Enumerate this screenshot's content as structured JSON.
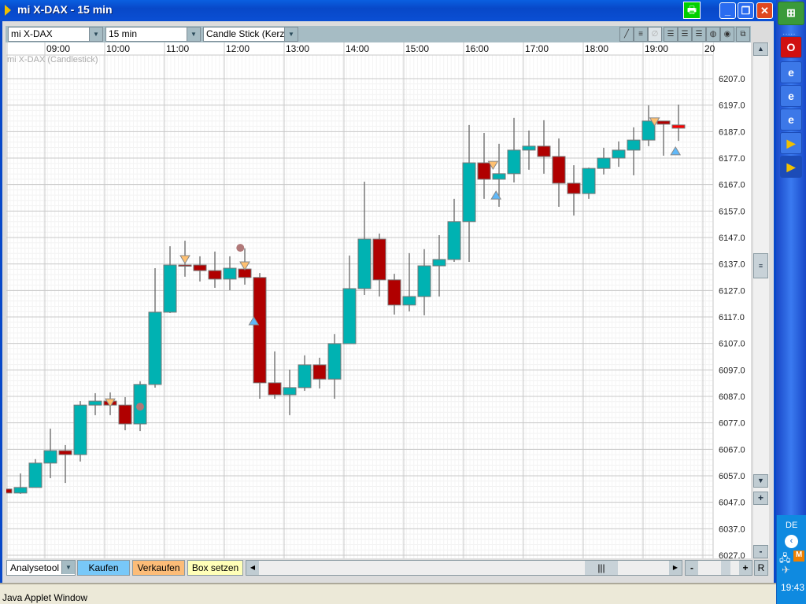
{
  "window": {
    "title": "mi X-DAX - 15 min",
    "status": "Java Applet Window"
  },
  "toolbar": {
    "instrument": "mi X-DAX",
    "interval": "15 min",
    "chart_type": "Candle Stick (Kerzen"
  },
  "chart_label": "mi X-DAX (Candlestick)",
  "bottom": {
    "tool": "Analysetool",
    "buy": "Kaufen",
    "sell": "Verkaufen",
    "box": "Box setzen",
    "reset": "R"
  },
  "taskbar": {
    "lang": "DE",
    "clock": "19:43"
  },
  "colors": {
    "up": "#00b2b2",
    "down": "#b00000",
    "current": "#ff0000",
    "sell_marker": "#ffc070",
    "buy_marker": "#60b8f8",
    "circle": "#b07878"
  },
  "chart_data": {
    "type": "candlestick",
    "title": "mi X-DAX (Candlestick)",
    "interval": "15 min",
    "time_ticks": [
      "",
      "09:00",
      "10:00",
      "11:00",
      "12:00",
      "13:00",
      "14:00",
      "15:00",
      "16:00",
      "17:00",
      "18:00",
      "19:00",
      "20"
    ],
    "price_ticks": [
      "6207.0",
      "6197.0",
      "6187.0",
      "6177.0",
      "6167.0",
      "6157.0",
      "6147.0",
      "6137.0",
      "6127.0",
      "6117.0",
      "6107.0",
      "6097.0",
      "6087.0",
      "6077.0",
      "6067.0",
      "6057.0",
      "6047.0",
      "6037.0",
      "6027.0"
    ],
    "ylim": [
      6027,
      6207
    ],
    "candles": [
      [
        6052.0,
        6050.5,
        6052.0,
        6050.5
      ],
      [
        6050.5,
        6052.6,
        6057.9,
        6050.2
      ],
      [
        6052.6,
        6061.8,
        6063.3,
        6052.6
      ],
      [
        6061.8,
        6066.5,
        6074.8,
        6056.1
      ],
      [
        6066.5,
        6065.0,
        6068.6,
        6054.3
      ],
      [
        6065.0,
        6083.7,
        6085.2,
        6062.4
      ],
      [
        6083.7,
        6085.2,
        6088.2,
        6079.9
      ],
      [
        6085.2,
        6083.7,
        6088.5,
        6079.9
      ],
      [
        6083.7,
        6076.6,
        6086.7,
        6074.2
      ],
      [
        6076.6,
        6091.5,
        6092.7,
        6073.9
      ],
      [
        6091.5,
        6118.8,
        6135.4,
        6090.3
      ],
      [
        6118.8,
        6136.6,
        6143.7,
        6118.5
      ],
      [
        6136.6,
        6136.6,
        6145.8,
        6132.2
      ],
      [
        6136.6,
        6134.5,
        6139.9,
        6130.4
      ],
      [
        6134.5,
        6131.3,
        6141.7,
        6128.0
      ],
      [
        6131.3,
        6135.4,
        6139.9,
        6127.1
      ],
      [
        6135.1,
        6131.9,
        6142.9,
        6129.2
      ],
      [
        6131.9,
        6092.1,
        6133.6,
        6086.1
      ],
      [
        6092.1,
        6087.6,
        6104.0,
        6086.1
      ],
      [
        6087.6,
        6090.3,
        6097.1,
        6079.9
      ],
      [
        6090.3,
        6098.9,
        6102.5,
        6089.1
      ],
      [
        6098.9,
        6093.5,
        6101.6,
        6090.0
      ],
      [
        6093.5,
        6106.9,
        6110.5,
        6086.1
      ],
      [
        6106.9,
        6127.7,
        6140.2,
        6106.9
      ],
      [
        6127.7,
        6146.4,
        6168.1,
        6125.3
      ],
      [
        6146.4,
        6131.0,
        6148.5,
        6124.7
      ],
      [
        6131.0,
        6121.5,
        6133.3,
        6117.9
      ],
      [
        6121.5,
        6124.7,
        6141.1,
        6119.1
      ],
      [
        6124.7,
        6136.3,
        6142.6,
        6117.6
      ],
      [
        6136.3,
        6138.7,
        6147.9,
        6124.7
      ],
      [
        6138.7,
        6153.0,
        6161.6,
        6137.8
      ],
      [
        6153.0,
        6175.2,
        6189.5,
        6137.8
      ],
      [
        6175.2,
        6169.0,
        6186.5,
        6161.6
      ],
      [
        6169.0,
        6171.1,
        6182.4,
        6158.6
      ],
      [
        6171.1,
        6180.0,
        6192.2,
        6167.8
      ],
      [
        6180.0,
        6181.5,
        6187.4,
        6172.6
      ],
      [
        6181.5,
        6177.6,
        6191.3,
        6171.1
      ],
      [
        6177.6,
        6167.5,
        6184.4,
        6158.6
      ],
      [
        6167.5,
        6163.6,
        6174.3,
        6155.3
      ],
      [
        6163.6,
        6173.1,
        6173.4,
        6161.6
      ],
      [
        6173.1,
        6177.0,
        6180.9,
        6170.8
      ],
      [
        6177.0,
        6180.0,
        6183.3,
        6173.7
      ],
      [
        6180.0,
        6183.8,
        6188.6,
        6170.5
      ],
      [
        6183.8,
        6191.0,
        6196.9,
        6181.5
      ],
      [
        6191.0,
        6189.8,
        6191.0,
        6177.9
      ],
      [
        6189.5,
        6188.3,
        6197.2,
        6183.5
      ]
    ],
    "candle_format": [
      "open",
      "close",
      "high",
      "low"
    ],
    "markers": [
      {
        "type": "sell",
        "index": 7,
        "price": 6084.6
      },
      {
        "type": "sell",
        "index": 12,
        "price": 6138.7
      },
      {
        "type": "sell",
        "index": 16,
        "price": 6136.3
      },
      {
        "type": "sell",
        "index": 32.6,
        "price": 6174.3
      },
      {
        "type": "sell",
        "index": 43.4,
        "price": 6190.7
      },
      {
        "type": "buy",
        "index": 16.6,
        "price": 6115.5
      },
      {
        "type": "buy",
        "index": 32.8,
        "price": 6163.0
      },
      {
        "type": "buy",
        "index": 44.8,
        "price": 6179.7
      },
      {
        "type": "circle",
        "index": 9,
        "price": 6083.1
      },
      {
        "type": "circle",
        "index": 15.7,
        "price": 6143.1
      }
    ]
  }
}
